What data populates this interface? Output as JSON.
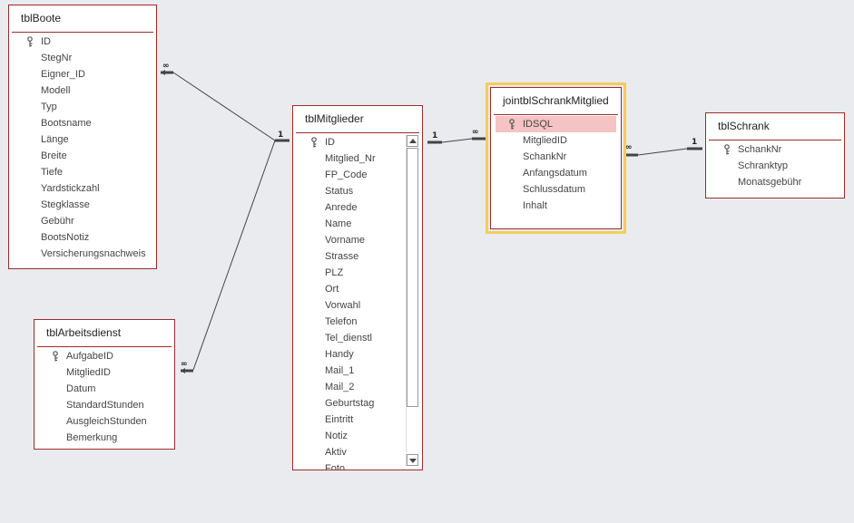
{
  "tables": {
    "boote": {
      "title": "tblBoote",
      "fields": [
        "ID",
        "StegNr",
        "Eigner_ID",
        "Modell",
        "Typ",
        "Bootsname",
        "Länge",
        "Breite",
        "Tiefe",
        "Yardstickzahl",
        "Stegklasse",
        "Gebühr",
        "BootsNotiz",
        "Versicherungsnachweis"
      ]
    },
    "arbeitsdienst": {
      "title": "tblArbeitsdienst",
      "fields": [
        "AufgabeID",
        "MitgliedID",
        "Datum",
        "StandardStunden",
        "AusgleichStunden",
        "Bemerkung"
      ]
    },
    "mitglieder": {
      "title": "tblMitglieder",
      "fields": [
        "ID",
        "Mitglied_Nr",
        "FP_Code",
        "Status",
        "Anrede",
        "Name",
        "Vorname",
        "Strasse",
        "PLZ",
        "Ort",
        "Vorwahl",
        "Telefon",
        "Tel_dienstl",
        "Handy",
        "Mail_1",
        "Mail_2",
        "Geburtstag",
        "Eintritt",
        "Notiz",
        "Aktiv",
        "Foto"
      ]
    },
    "joint": {
      "title": "jointblSchrankMitglied",
      "fields": [
        "IDSQL",
        "MitgliedID",
        "SchankNr",
        "Anfangsdatum",
        "Schlussdatum",
        "Inhalt"
      ]
    },
    "schrank": {
      "title": "tblSchrank",
      "fields": [
        "SchankNr",
        "Schranktyp",
        "Monatsgebühr"
      ]
    }
  },
  "relations": {
    "one": "1",
    "many": "∞"
  },
  "icons": {
    "primary_key": "key-icon",
    "scroll_up": "scroll-up-arrow-icon",
    "scroll_down": "scroll-down-arrow-icon"
  },
  "colors": {
    "table_border": "#9c2b2b",
    "selected_row": "#f4c3c3",
    "active_outline": "#f5cd5b",
    "background": "#e9ebee"
  }
}
